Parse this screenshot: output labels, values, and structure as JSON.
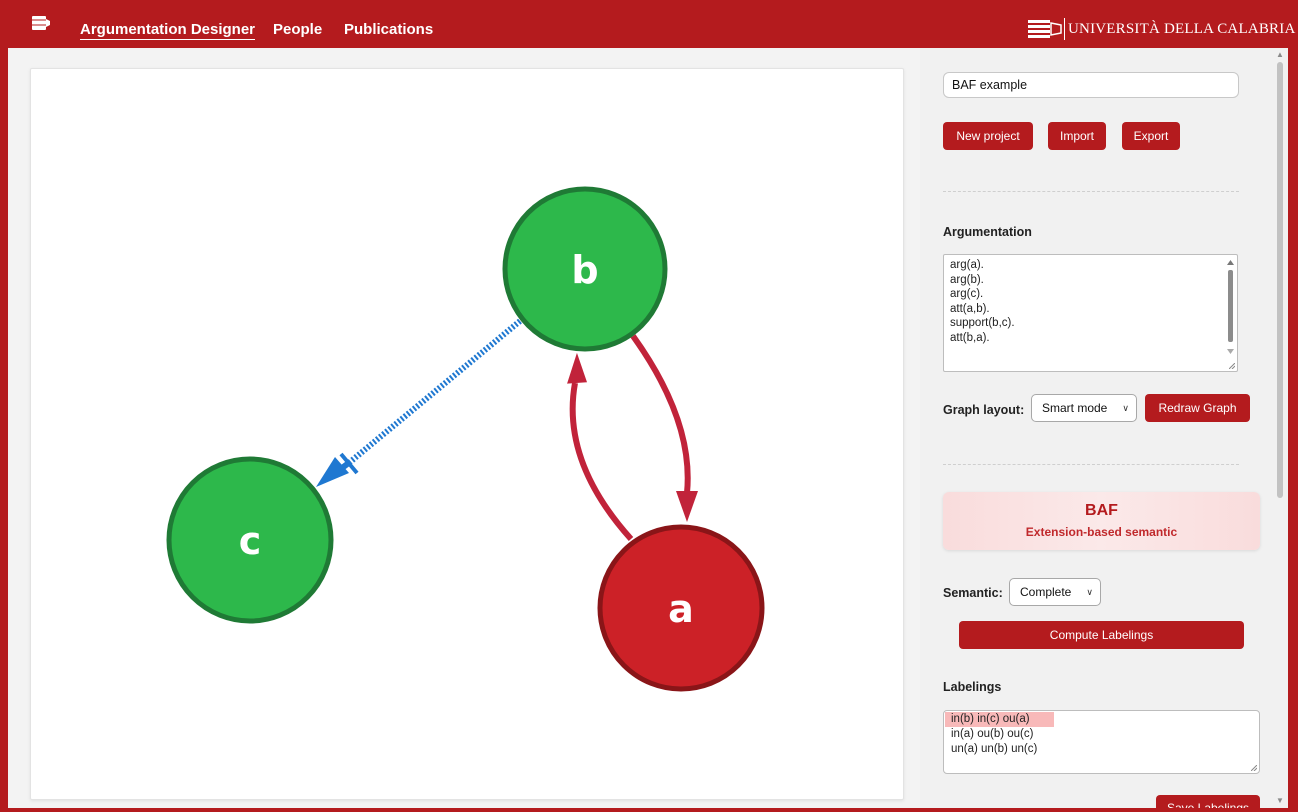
{
  "navbar": {
    "logo_icon": "book-icon",
    "links": [
      "Argumentation Designer",
      "People",
      "Publications"
    ],
    "active_link": "Argumentation Designer",
    "university": "UNIVERSITÀ DELLA CALABRIA"
  },
  "graph": {
    "nodes": [
      {
        "id": "b",
        "label": "b",
        "color": "#2db84b"
      },
      {
        "id": "c",
        "label": "c",
        "color": "#2db84b"
      },
      {
        "id": "a",
        "label": "a",
        "color": "#cc2127"
      }
    ],
    "edges": [
      {
        "from": "a",
        "to": "b",
        "type": "attack",
        "color": "#c1233a"
      },
      {
        "from": "b",
        "to": "a",
        "type": "attack",
        "color": "#c1233a"
      },
      {
        "from": "b",
        "to": "c",
        "type": "support",
        "color": "#1f78d1"
      }
    ]
  },
  "panel": {
    "project_name": "BAF example",
    "buttons": {
      "new_project": "New project",
      "import": "Import",
      "export": "Export"
    },
    "argumentation": {
      "label": "Argumentation",
      "lines": [
        "arg(a).",
        "arg(b).",
        "arg(c).",
        "att(a,b).",
        "support(b,c).",
        "att(b,a)."
      ]
    },
    "graph_layout": {
      "label": "Graph layout:",
      "selected": "Smart mode",
      "redraw": "Redraw Graph"
    },
    "framework": {
      "title": "BAF",
      "subtitle": "Extension-based semantic"
    },
    "semantic": {
      "label": "Semantic:",
      "selected": "Complete",
      "compute": "Compute Labelings"
    },
    "labelings": {
      "label": "Labelings",
      "items": [
        "in(b) in(c) ou(a)",
        "in(a) ou(b) ou(c)",
        "un(a) un(b) un(c)"
      ],
      "selected_index": 0,
      "save": "Save Labelings"
    }
  },
  "colors": {
    "brand": "#b41b1e",
    "in_node": "#2db84b",
    "out_node": "#cc2127",
    "support_edge": "#1f78d1"
  }
}
